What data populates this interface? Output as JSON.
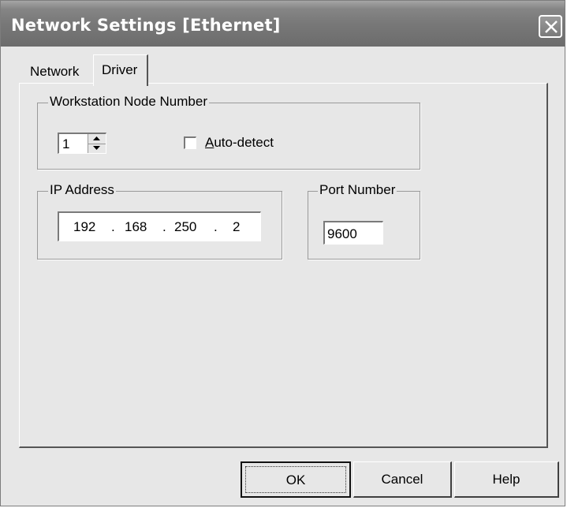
{
  "window": {
    "title": "Network Settings [Ethernet]"
  },
  "tabs": [
    {
      "label": "Network",
      "selected": false
    },
    {
      "label": "Driver",
      "selected": true
    }
  ],
  "node_group": {
    "legend": "Workstation Node Number",
    "node_number": "1",
    "auto_detect": {
      "label_accel": "A",
      "label_rest": "uto-detect",
      "checked": false
    }
  },
  "ip_group": {
    "legend": "IP Address",
    "octets": [
      "192",
      "168",
      "250",
      "2"
    ],
    "separator": "."
  },
  "port_group": {
    "legend": "Port Number",
    "value": "9600"
  },
  "buttons": {
    "ok": "OK",
    "cancel": "Cancel",
    "help": "Help"
  }
}
